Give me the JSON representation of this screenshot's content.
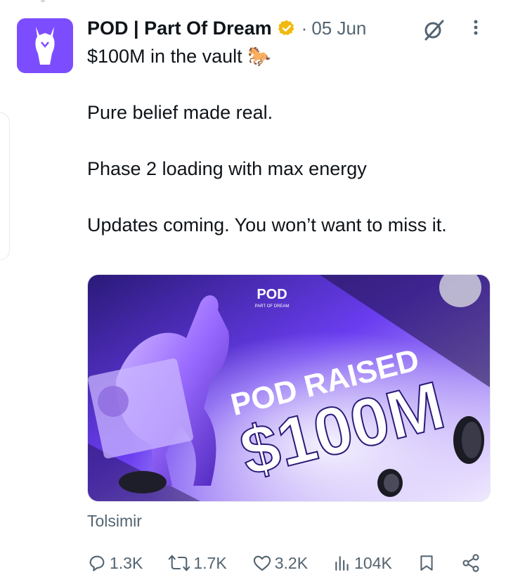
{
  "author": {
    "name": "POD | Part Of Dream",
    "date": "05 Jun",
    "separator": "·",
    "verified": true,
    "avatar_icon": "horse-icon",
    "avatar_color": "#7c4dff",
    "verified_color": "#f0b90b"
  },
  "tweet": {
    "line1": "$100M in the vault 🐎",
    "line2": "Pure belief made real.",
    "line3": "Phase 2 loading with max energy",
    "line4": "Updates coming. You won’t want to miss it."
  },
  "media": {
    "logo_text": "POD",
    "logo_subtext": "PART OF DREAM",
    "headline": "POD RAISED",
    "amount": "$100M",
    "accent_color": "#6a3df0"
  },
  "source": "Tolsimir",
  "actions": {
    "reply": "1.3K",
    "repost": "1.7K",
    "like": "3.2K",
    "views": "104K",
    "icons": [
      "reply-icon",
      "repost-icon",
      "like-icon",
      "views-icon",
      "bookmark-icon",
      "share-icon"
    ]
  }
}
